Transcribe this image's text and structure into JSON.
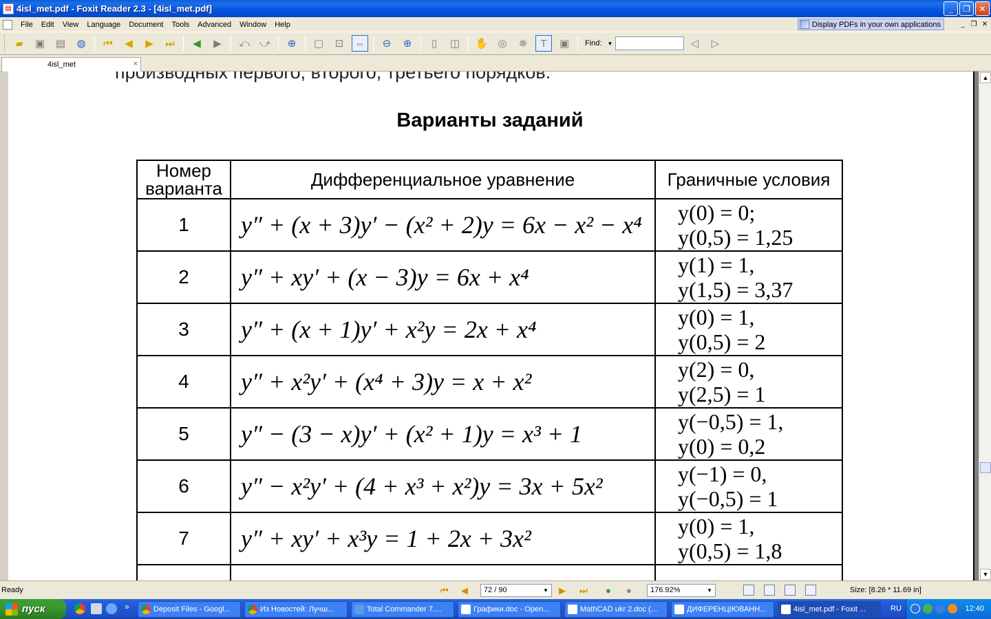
{
  "window": {
    "title": "4isl_met.pdf - Foxit Reader 2.3 - [4isl_met.pdf]",
    "min_label": "_",
    "restore_label": "❐",
    "close_label": "✕"
  },
  "menu": {
    "items": [
      "File",
      "Edit",
      "View",
      "Language",
      "Document",
      "Tools",
      "Advanced",
      "Window",
      "Help"
    ],
    "promo": "Display PDFs in your own applications"
  },
  "toolbar": {
    "find_label": "Find:",
    "find_value": ""
  },
  "tab": {
    "label": "4isl_met",
    "close": "×"
  },
  "document": {
    "cut_text": "производных первого, второго, третьего порядков.",
    "heading": "Варианты заданий",
    "table": {
      "headers": [
        "Номер варианта",
        "Дифференциальное уравнение",
        "Граничные условия"
      ],
      "rows": [
        {
          "num": "1",
          "eq": "y″ + (x + 3)y′ − (x² + 2)y = 6x − x² − x⁴",
          "bc1": "y(0) = 0;",
          "bc2": "y(0,5) = 1,25"
        },
        {
          "num": "2",
          "eq": "y″ + xy′ + (x − 3)y = 6x + x⁴",
          "bc1": "y(1) = 1,",
          "bc2": "y(1,5) = 3,37"
        },
        {
          "num": "3",
          "eq": "y″ + (x + 1)y′ + x²y = 2x + x⁴",
          "bc1": "y(0) = 1,",
          "bc2": "y(0,5) = 2"
        },
        {
          "num": "4",
          "eq": "y″ + x²y′ + (x⁴ + 3)y = x + x²",
          "bc1": "y(2) = 0,",
          "bc2": "y(2,5) = 1"
        },
        {
          "num": "5",
          "eq": "y″ − (3 − x)y′ + (x² + 1)y = x³ + 1",
          "bc1": "y(−0,5) = 1,",
          "bc2": "y(0) = 0,2"
        },
        {
          "num": "6",
          "eq": "y″ − x²y′ + (4 + x³ + x²)y = 3x + 5x²",
          "bc1": "y(−1) = 0,",
          "bc2": "y(−0,5) = 1"
        },
        {
          "num": "7",
          "eq": "y″ + xy′ + x³y = 1 + 2x + 3x²",
          "bc1": "y(0) = 1,",
          "bc2": "y(0,5) = 1,8"
        }
      ]
    }
  },
  "statusbar": {
    "status": "Ready",
    "page_value": "72 / 90",
    "zoom_value": "176.92%",
    "size": "Size: [8.26 * 11.69 in]"
  },
  "taskbar": {
    "start": "пуск",
    "more": "»",
    "tasks": [
      "Deposit Files - Googl...",
      "Из Новостей: Лучш...",
      "Total Commander 7....",
      "Графики.doc - Open...",
      "MathCAD ukr 2.doc (...",
      "ДИФЕРЕНЦІЮВАНН...",
      "4isl_met.pdf - Foxit ..."
    ],
    "lang": "RU",
    "clock": "12:40"
  },
  "colors": {
    "titlebar": "#0055e3",
    "taskbar": "#245edb",
    "start": "#3a9a2e",
    "tray": "#0f8bee"
  }
}
